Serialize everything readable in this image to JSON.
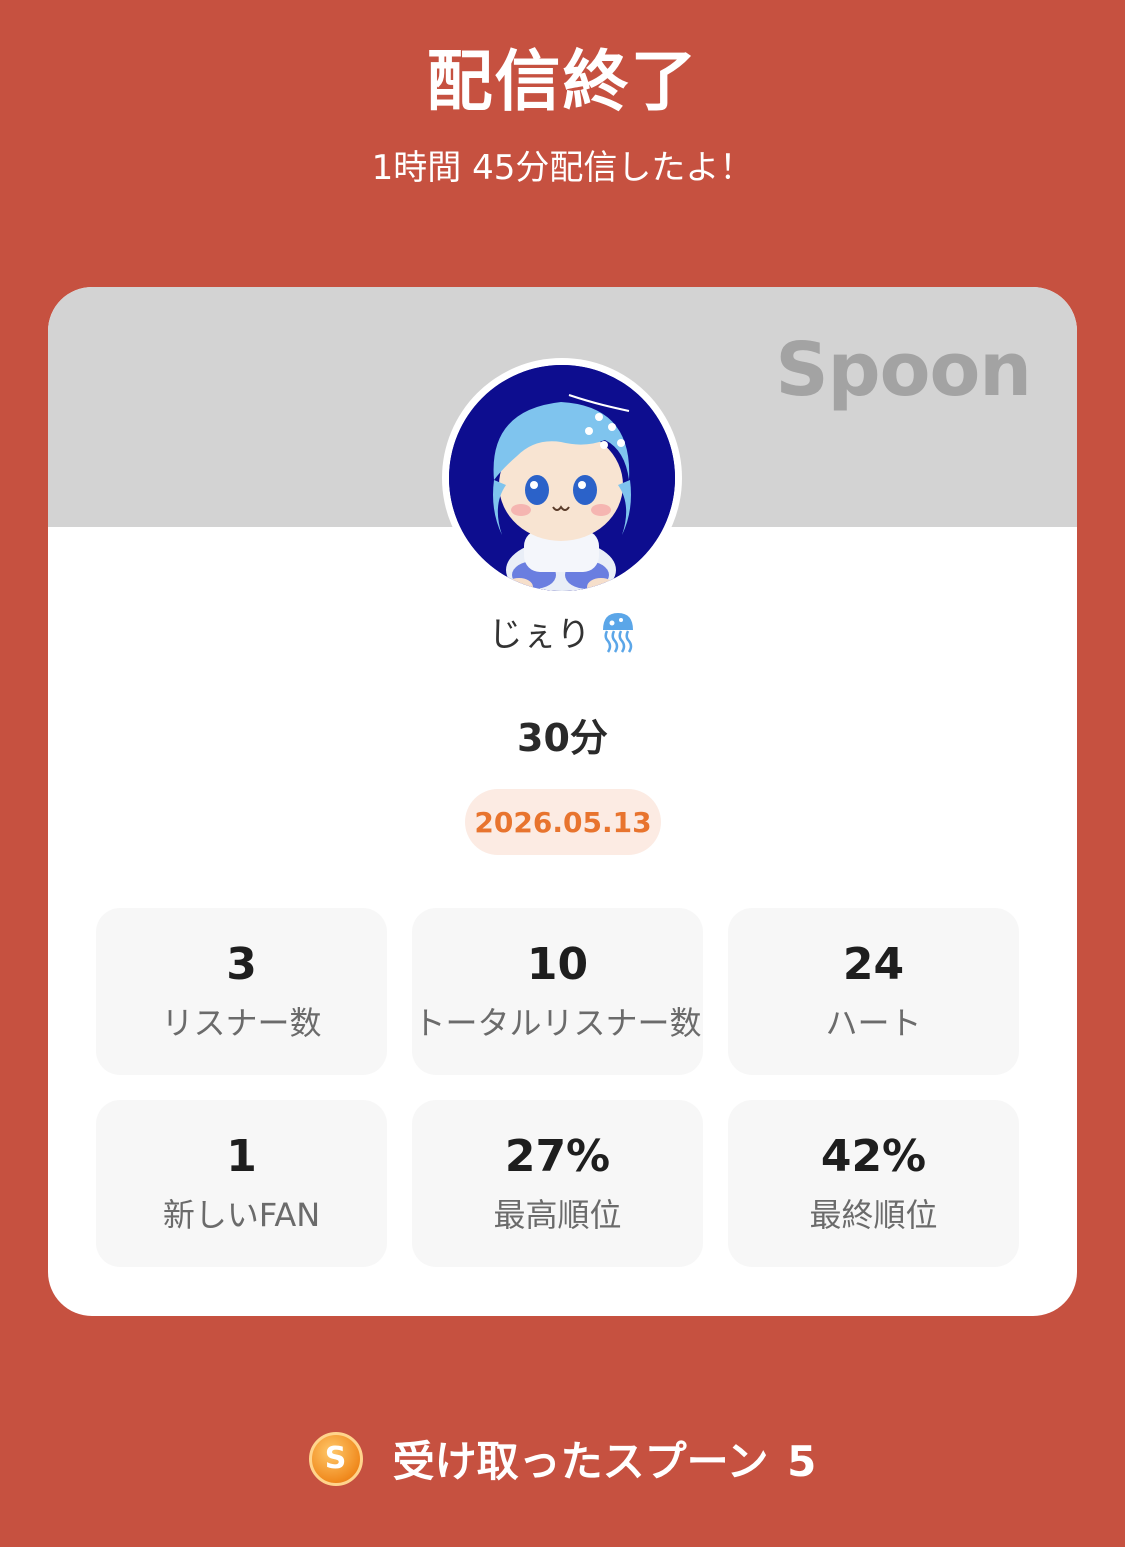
{
  "header": {
    "title": "配信終了",
    "subtitle": "1時間 45分配信したよ！"
  },
  "card": {
    "brand": "Spoon",
    "username": "じぇり",
    "username_emoji": "jellyfish-icon",
    "duration": "30分",
    "date": "2026.05.13"
  },
  "stats": [
    {
      "value": "3",
      "label": "リスナー数"
    },
    {
      "value": "10",
      "label": "トータルリスナー数"
    },
    {
      "value": "24",
      "label": "ハート"
    },
    {
      "value": "1",
      "label": "新しいFAN"
    },
    {
      "value": "27%",
      "label": "最高順位"
    },
    {
      "value": "42%",
      "label": "最終順位"
    }
  ],
  "footer": {
    "coin_letter": "S",
    "label": "受け取ったスプーン",
    "count": "5"
  },
  "colors": {
    "background": "#c65140",
    "card": "#ffffff",
    "card_header": "#d3d3d3",
    "date_badge_bg": "#fcebe3",
    "date_badge_text": "#e8742e",
    "stat_tile": "#f7f7f7"
  }
}
